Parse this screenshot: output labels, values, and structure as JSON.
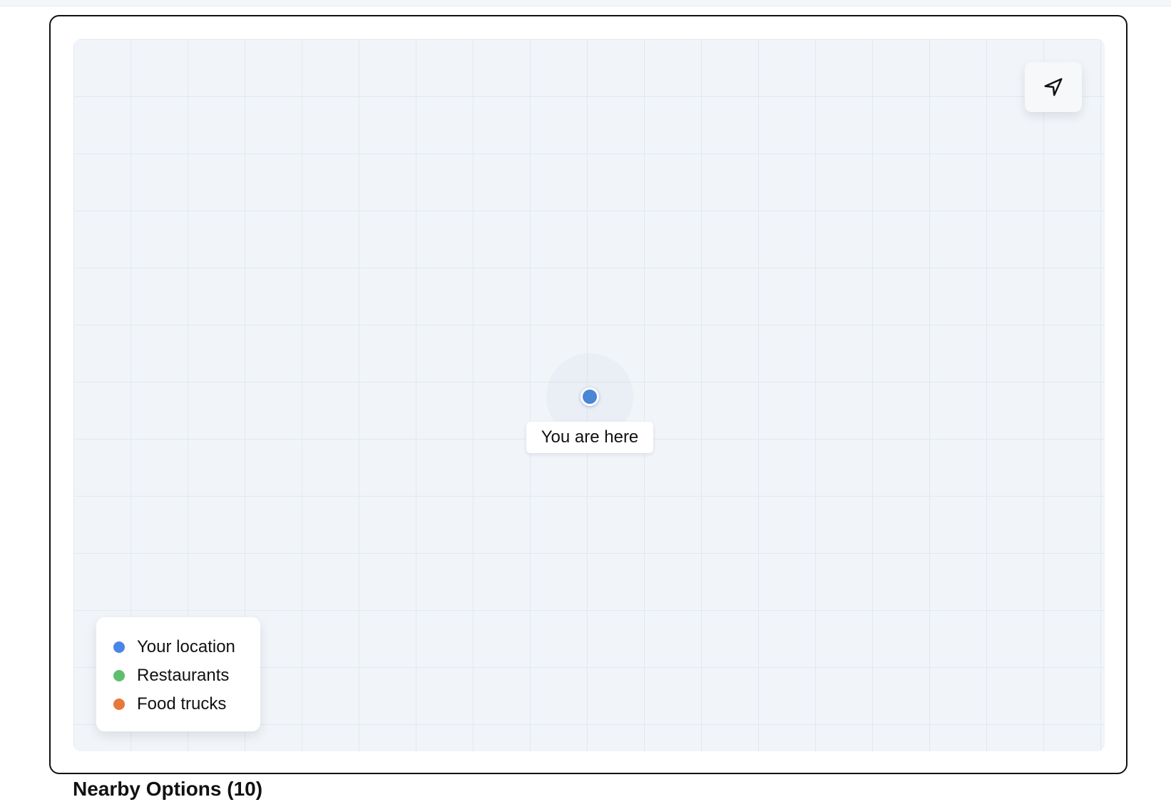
{
  "map": {
    "locate_button_label": "Recenter map",
    "user_marker": {
      "label": "You are here",
      "color": "#4a86d6"
    },
    "legend": {
      "items": [
        {
          "label": "Your location",
          "color": "#4a86e8"
        },
        {
          "label": "Restaurants",
          "color": "#5cbf6e"
        },
        {
          "label": "Food trucks",
          "color": "#e8773a"
        }
      ]
    }
  },
  "nearby": {
    "title": "Nearby Options (10)"
  },
  "icons": {
    "locate": "navigation-arrow-icon",
    "marker": "location-dot-icon"
  }
}
